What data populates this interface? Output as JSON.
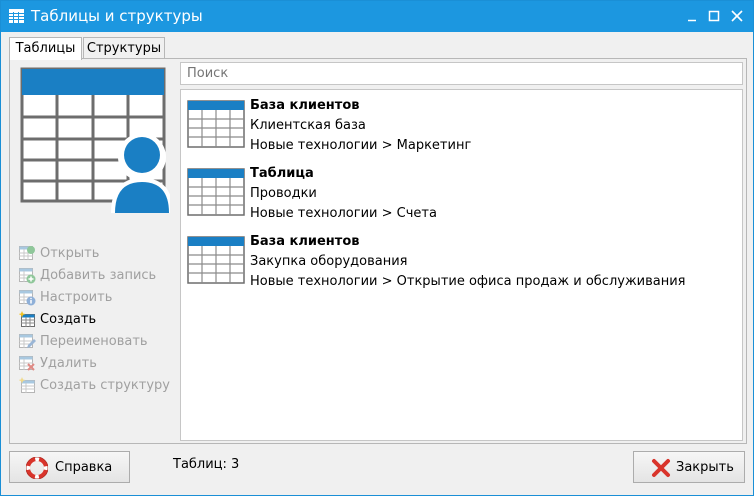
{
  "window": {
    "title": "Таблицы и структуры",
    "controls": [
      "minimize",
      "maximize",
      "close"
    ]
  },
  "tabs": [
    {
      "label": "Таблицы",
      "active": true
    },
    {
      "label": "Структуры",
      "active": false
    }
  ],
  "sidebar": {
    "hero_icon": "table-user-icon",
    "actions": [
      {
        "label": "Открыть",
        "icon": "table-open-icon",
        "enabled": false
      },
      {
        "label": "Добавить запись",
        "icon": "table-add-icon",
        "enabled": false
      },
      {
        "label": "Настроить",
        "icon": "table-info-icon",
        "enabled": false
      },
      {
        "label": "Создать",
        "icon": "table-new-icon",
        "enabled": true
      },
      {
        "label": "Переименовать",
        "icon": "table-rename-icon",
        "enabled": false
      },
      {
        "label": "Удалить",
        "icon": "table-delete-icon",
        "enabled": false
      },
      {
        "label": "Создать структуру",
        "icon": "structure-new-icon",
        "enabled": false
      }
    ]
  },
  "search": {
    "placeholder": "Поиск",
    "value": ""
  },
  "list": {
    "items": [
      {
        "title": "База клиентов",
        "subtitle": "Клиентская база",
        "path": "Новые технологии > Маркетинг"
      },
      {
        "title": "Таблица",
        "subtitle": "Проводки",
        "path": "Новые технологии > Счета"
      },
      {
        "title": "База клиентов",
        "subtitle": "Закупка оборудования",
        "path": "Новые технологии > Открытие офиса продаж и обслуживания"
      }
    ]
  },
  "footer": {
    "help_label": "Справка",
    "status_text": "Таблиц: 3",
    "close_label": "Закрыть"
  },
  "colors": {
    "titlebar": "#1c97e0",
    "accent": "#1a7fc4",
    "close_red": "#d9342b"
  }
}
